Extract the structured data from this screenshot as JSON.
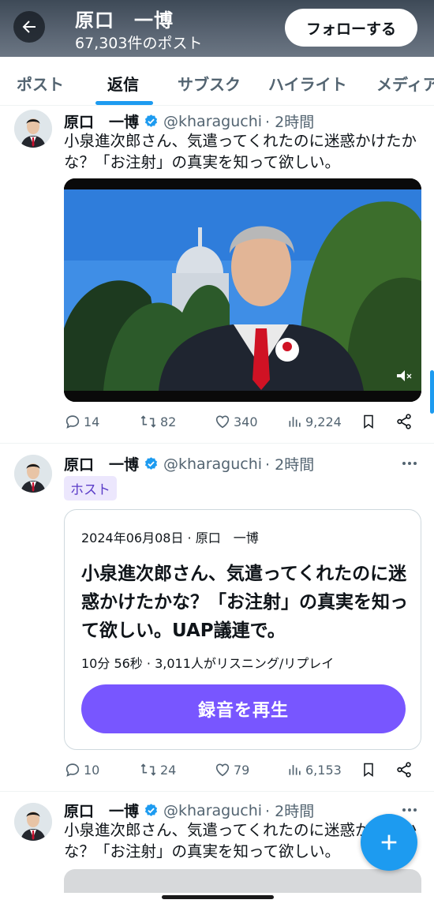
{
  "header": {
    "name": "原口　一博",
    "post_count": "67,303件のポスト",
    "follow_label": "フォローする",
    "icons": {
      "back": "arrow-left-icon"
    }
  },
  "tabs": [
    {
      "label": "ポスト"
    },
    {
      "label": "返信",
      "active": true
    },
    {
      "label": "サブスク"
    },
    {
      "label": "ハイライト"
    },
    {
      "label": "メディア"
    }
  ],
  "tweets": [
    {
      "author": "原口　一博",
      "handle": "@kharaguchi",
      "time": "· 2時間",
      "text": "小泉進次郎さん、気遣ってくれたのに迷惑かけたかな？「お注射」の真実を知って欲しい。",
      "media": "video",
      "stats": {
        "replies": "14",
        "reposts": "82",
        "likes": "340",
        "views": "9,224"
      }
    },
    {
      "author": "原口　一博",
      "handle": "@kharaguchi",
      "time": "· 2時間",
      "badge": "ホスト",
      "space": {
        "meta": "2024年06月08日 · 原口　一博",
        "title": "小泉進次郎さん、気遣ってくれたのに迷惑かけたかな？「お注射」の真実を知って欲しい。UAP議連で。",
        "stats": "10分 56秒 · 3,011人がリスニング/リプレイ",
        "button": "録音を再生"
      },
      "stats": {
        "replies": "10",
        "reposts": "24",
        "likes": "79",
        "views": "6,153"
      }
    },
    {
      "author": "原口　一博",
      "handle": "@kharaguchi",
      "time": "· 2時間",
      "text": "小泉進次郎さん、気遣ってくれたのに迷惑かけたかな？「お注射」の真実を知って欲しい。"
    }
  ],
  "colors": {
    "accent": "#1d9bf0",
    "space_purple": "#7856ff",
    "text_secondary": "#536471"
  }
}
